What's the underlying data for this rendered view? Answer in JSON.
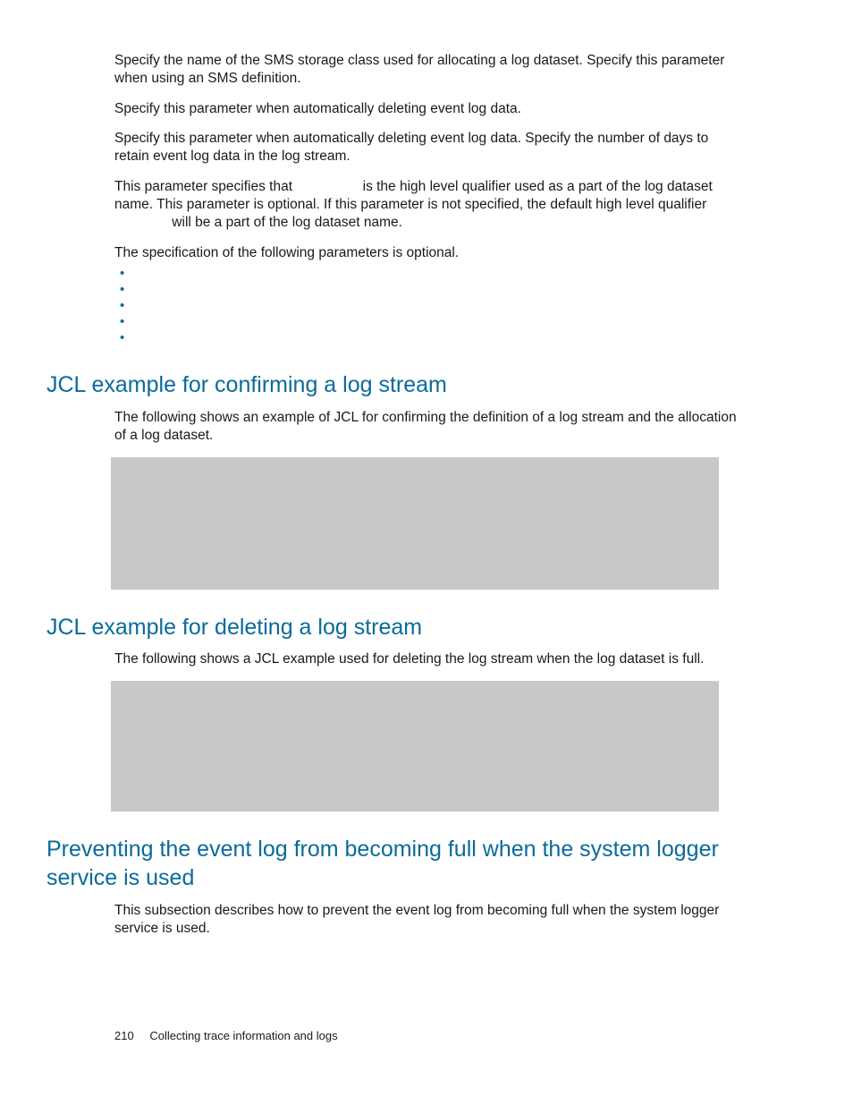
{
  "body": {
    "para1": "Specify the name of the SMS storage class used for allocating a log dataset. Specify this parameter when using an SMS definition.",
    "para2": "Specify this parameter when automatically deleting event log data.",
    "para3": "Specify this parameter when automatically deleting event log data. Specify the number of days to retain event log data in the log stream.",
    "para4_a": "This parameter specifies that ",
    "para4_b": " is the high level qualifier used as a part of the log dataset name. This parameter is optional. If this parameter is not specified, the default high level qualifier ",
    "para4_c": " will be a part of the log dataset name.",
    "opt_intro": "The specification of the following parameters is optional.",
    "bullets": [
      "",
      "",
      "",
      "",
      ""
    ]
  },
  "sections": {
    "confirm": {
      "title": "JCL example for confirming a log stream",
      "intro": "The following shows an example of JCL for confirming the definition of a log stream and the allocation of a log dataset."
    },
    "delete": {
      "title": "JCL example for deleting a log stream",
      "intro": "The following shows a JCL example used for deleting the log stream when the log dataset is full."
    },
    "prevent": {
      "title": "Preventing the event log from becoming full when the system logger service is used",
      "intro": "This subsection describes how to prevent the event log from becoming full when the system logger service is used."
    }
  },
  "footer": {
    "page_number": "210",
    "chapter": "Collecting trace information and logs"
  }
}
